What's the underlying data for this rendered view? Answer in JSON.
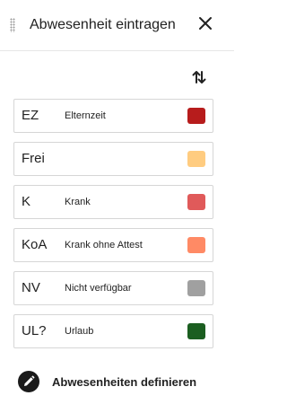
{
  "header": {
    "title": "Abwesenheit eintragen"
  },
  "items": [
    {
      "code": "EZ",
      "label": "Elternzeit",
      "color": "#b71c1c"
    },
    {
      "code": "Frei",
      "label": "",
      "color": "#ffcc80"
    },
    {
      "code": "K",
      "label": "Krank",
      "color": "#e05a5a"
    },
    {
      "code": "KoA",
      "label": "Krank ohne Attest",
      "color": "#ff8a65"
    },
    {
      "code": "NV",
      "label": "Nicht verfügbar",
      "color": "#a0a0a0"
    },
    {
      "code": "UL?",
      "label": "Urlaub",
      "color": "#1b5e20"
    }
  ],
  "footer": {
    "define_label": "Abwesenheiten definieren"
  },
  "icons": {
    "close": "close-icon",
    "sort": "sort-icon",
    "edit": "pencil-icon",
    "drag": "drag-handle-icon"
  }
}
